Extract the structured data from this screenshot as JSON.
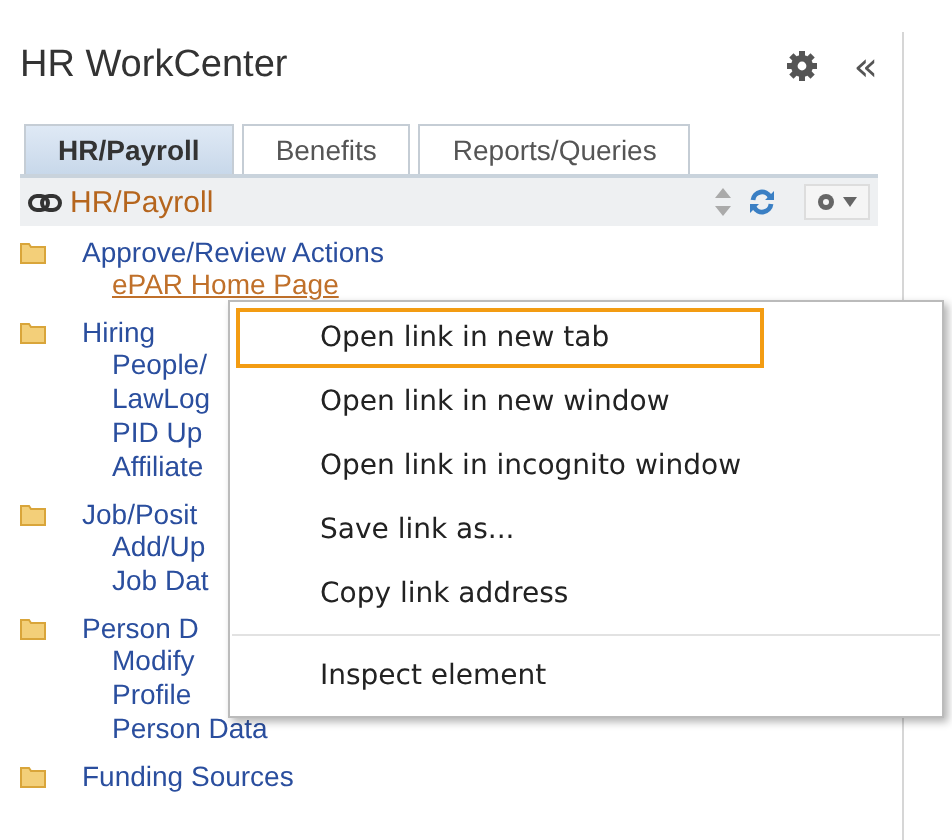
{
  "header": {
    "title": "HR WorkCenter",
    "collapse": "«"
  },
  "tabs": [
    {
      "label": "HR/Payroll",
      "selected": true
    },
    {
      "label": "Benefits",
      "selected": false
    },
    {
      "label": "Reports/Queries",
      "selected": false
    }
  ],
  "section": {
    "title": "HR/Payroll"
  },
  "tree": [
    {
      "label": "Approve/Review Actions",
      "children": [
        {
          "label": "ePAR Home Page",
          "hovered": true
        }
      ]
    },
    {
      "label": "Hiring",
      "children": [
        {
          "label": "People/",
          "hovered": false
        },
        {
          "label": "LawLog",
          "hovered": false
        },
        {
          "label": "PID Up",
          "hovered": false
        },
        {
          "label": "Affiliate",
          "hovered": false
        }
      ]
    },
    {
      "label": "Job/Posit",
      "children": [
        {
          "label": "Add/Up",
          "hovered": false
        },
        {
          "label": "Job Dat",
          "hovered": false
        }
      ]
    },
    {
      "label": "Person D",
      "children": [
        {
          "label": "Modify",
          "hovered": false
        },
        {
          "label": "Profile",
          "hovered": false
        },
        {
          "label": "Person Data",
          "hovered": false
        }
      ]
    },
    {
      "label": "Funding Sources"
    }
  ],
  "context_menu": {
    "groups": [
      [
        {
          "label": "Open link in new tab",
          "selected": true
        },
        {
          "label": "Open link in new window",
          "selected": false
        },
        {
          "label": "Open link in incognito window",
          "selected": false
        },
        {
          "label": "Save link as...",
          "selected": false
        },
        {
          "label": "Copy link address",
          "selected": false
        }
      ],
      [
        {
          "label": "Inspect element",
          "selected": false
        }
      ]
    ]
  }
}
